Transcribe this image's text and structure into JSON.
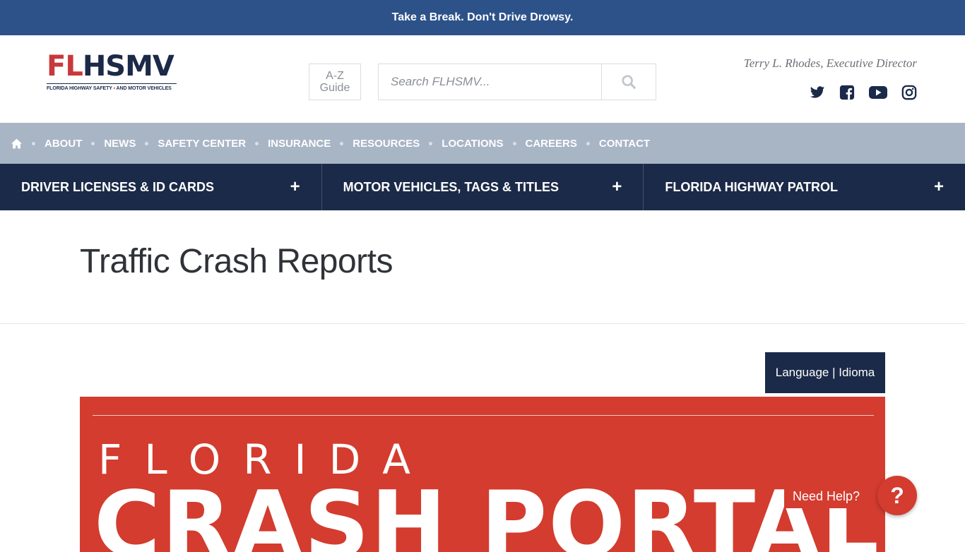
{
  "alert_bar": {
    "text": "Take a Break. Don't Drive Drowsy."
  },
  "logo": {
    "text_red": "FL",
    "text_navy": "HSMV",
    "tagline_left": "FLORIDA HIGHWAY SAFETY",
    "tagline_right": "AND MOTOR VEHICLES"
  },
  "header": {
    "az_line1": "A-Z",
    "az_line2": "Guide",
    "search_placeholder": "Search FLHSMV...",
    "director": "Terry L. Rhodes, Executive Director",
    "social": [
      "twitter-icon",
      "facebook-icon",
      "youtube-icon",
      "instagram-icon"
    ]
  },
  "nav_primary": {
    "home_icon": "home-icon",
    "items": [
      "ABOUT",
      "NEWS",
      "SAFETY CENTER",
      "INSURANCE",
      "RESOURCES",
      "LOCATIONS",
      "CAREERS",
      "CONTACT"
    ]
  },
  "nav_secondary": {
    "items": [
      {
        "label": "DRIVER LICENSES & ID CARDS",
        "expand": "+"
      },
      {
        "label": "MOTOR VEHICLES, TAGS & TITLES",
        "expand": "+"
      },
      {
        "label": "FLORIDA HIGHWAY PATROL",
        "expand": "+"
      }
    ]
  },
  "page": {
    "title": "Traffic Crash Reports"
  },
  "language_button": {
    "label": "Language | Idioma"
  },
  "banner": {
    "line1": "FLORIDA",
    "line2": "CRASH PORTAL"
  },
  "help": {
    "label": "Need Help?",
    "icon_text": "?"
  },
  "colors": {
    "accent_blue": "#2c5289",
    "navy": "#1b2a48",
    "red": "#d33c2e",
    "nav_gray": "#a8b5c5"
  }
}
